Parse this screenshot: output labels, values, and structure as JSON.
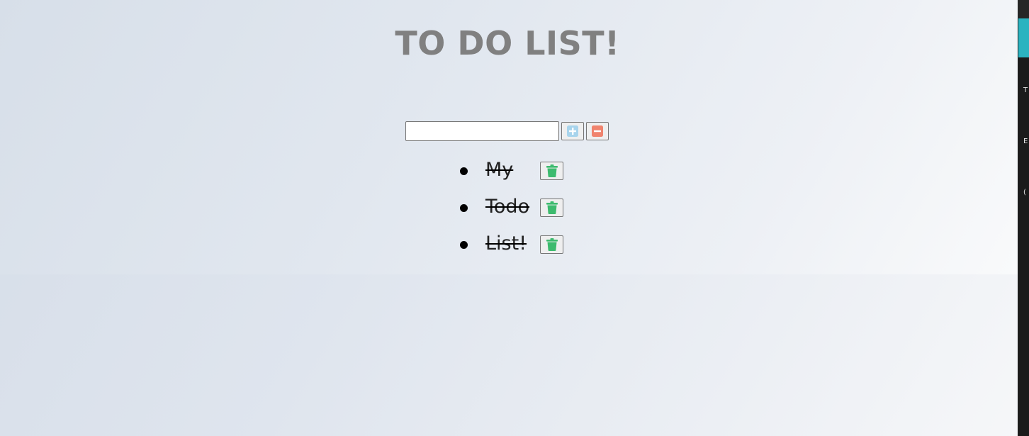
{
  "app": {
    "title": "TO DO LIST!"
  },
  "input": {
    "value": "",
    "placeholder": ""
  },
  "buttons": {
    "add_icon": "plus-square-icon",
    "remove_icon": "minus-square-icon",
    "add_color": "#a8d4ec",
    "remove_color": "#f0836d"
  },
  "todos": [
    {
      "text": "My",
      "completed": true
    },
    {
      "text": "Todo",
      "completed": true
    },
    {
      "text": "List!",
      "completed": true
    }
  ],
  "trash_icon": "trash-icon",
  "colors": {
    "title": "#808080",
    "trash": "#3dbb6e",
    "side_accent": "#2bb3c0",
    "side_panel": "#1b1b1b"
  },
  "side_panel": {
    "letters": [
      "T",
      "E",
      "("
    ]
  }
}
